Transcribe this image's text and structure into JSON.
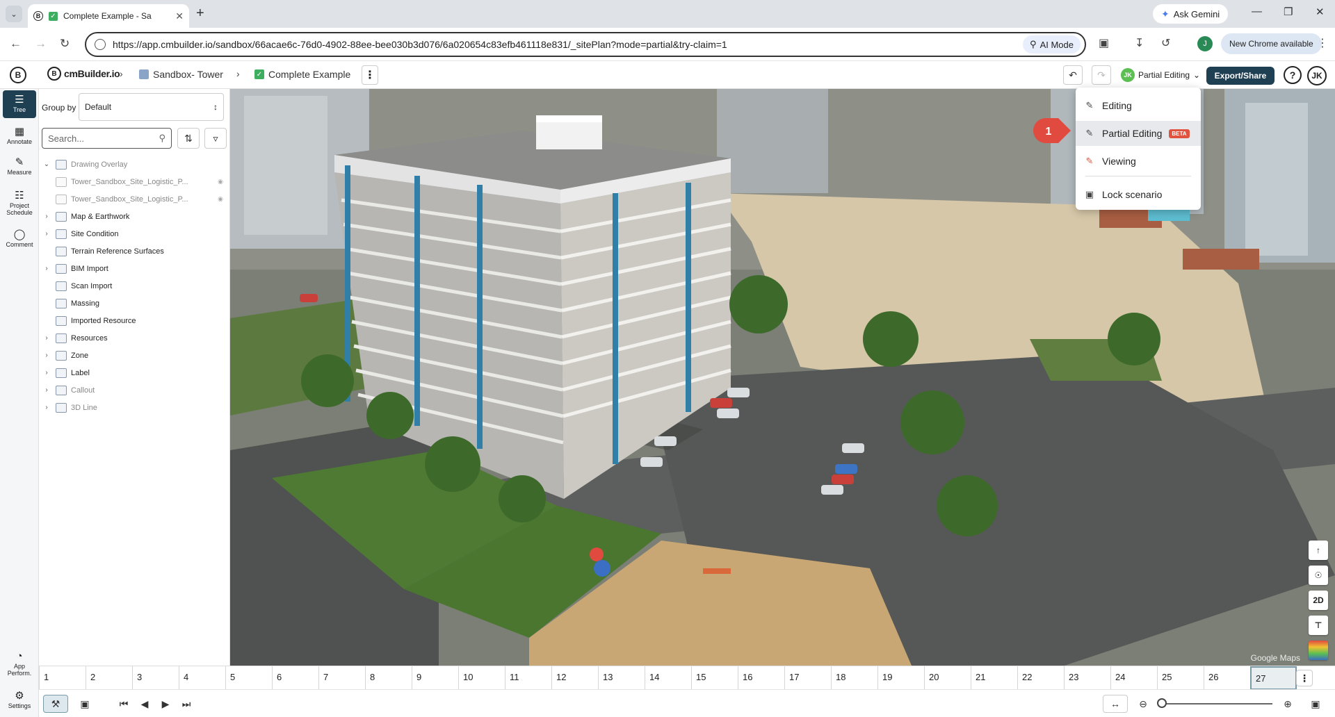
{
  "browser": {
    "tab_title": "Complete Example - Sa",
    "new_tab_icon": "+",
    "ask_gemini": "Ask Gemini",
    "url": "https://app.cmbuilder.io/sandbox/66acae6c-76d0-4902-88ee-bee030b3d076/6a020654c83efb461118e831/_sitePlan?mode=partial&try-claim=1",
    "ai_mode": "AI Mode",
    "profile_initial": "J",
    "new_chrome": "New Chrome available"
  },
  "header": {
    "app_icon": "B",
    "brand": "cmBuilder.io",
    "breadcrumb": [
      "Sandbox- Tower",
      "Complete Example"
    ],
    "mode_avatar": "JK",
    "mode_label": "Partial Editing",
    "export_label": "Export/Share",
    "help": "?",
    "user_initials": "JK"
  },
  "left_tools": [
    {
      "label": "Tree",
      "icon": "tree-icon"
    },
    {
      "label": "Annotate",
      "icon": "annotate-icon"
    },
    {
      "label": "Measure",
      "icon": "measure-icon"
    },
    {
      "label": "Project Schedule",
      "icon": "schedule-icon"
    },
    {
      "label": "Comment",
      "icon": "comment-icon"
    },
    {
      "label": "App Perform.",
      "icon": "performance-icon"
    },
    {
      "label": "Settings",
      "icon": "gear-icon"
    }
  ],
  "tree": {
    "group_by_label": "Group by",
    "group_by_value": "Default",
    "search_placeholder": "Search...",
    "items": [
      {
        "label": "Drawing Overlay",
        "expanded": true,
        "muted": true
      },
      {
        "label": "Tower_Sandbox_Site_Logistic_P...",
        "child": true
      },
      {
        "label": "Tower_Sandbox_Site_Logistic_P...",
        "child": true
      },
      {
        "label": "Map & Earthwork"
      },
      {
        "label": "Site Condition"
      },
      {
        "label": "Terrain Reference Surfaces"
      },
      {
        "label": "BIM Import"
      },
      {
        "label": "Scan Import"
      },
      {
        "label": "Massing"
      },
      {
        "label": "Imported Resource"
      },
      {
        "label": "Resources"
      },
      {
        "label": "Zone"
      },
      {
        "label": "Label"
      },
      {
        "label": "Callout",
        "muted": true
      },
      {
        "label": "3D Line",
        "muted": true
      }
    ]
  },
  "mode_menu": {
    "items": [
      {
        "label": "Editing",
        "icon": "pencil-icon"
      },
      {
        "label": "Partial Editing",
        "icon": "partial-pencil-icon",
        "badge": "BETA",
        "selected": true
      },
      {
        "label": "Viewing",
        "icon": "eye-icon"
      }
    ],
    "lock_label": "Lock scenario",
    "step_marker": "1"
  },
  "viewport": {
    "watermark": "Google Maps",
    "tools": [
      "north-arrow-icon",
      "globe-icon",
      "2D",
      "layers-icon",
      "color-ramp-icon"
    ]
  },
  "timeline": {
    "ticks": [
      "1",
      "2",
      "3",
      "4",
      "5",
      "6",
      "7",
      "8",
      "9",
      "10",
      "11",
      "12",
      "13",
      "14",
      "15",
      "16",
      "17",
      "18",
      "19",
      "20",
      "21",
      "22",
      "23",
      "24",
      "25",
      "26",
      "27"
    ],
    "current": "27"
  },
  "colors": {
    "accent": "#1f3f52",
    "beta": "#e0533e",
    "avatar_green": "#5bbf52",
    "marker_red": "#e04a3f"
  }
}
